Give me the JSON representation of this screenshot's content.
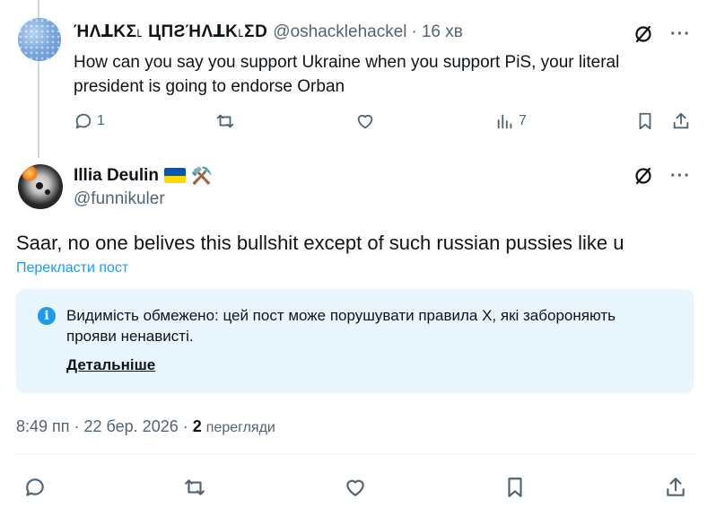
{
  "reply": {
    "author_name": "ΉΛꓕΚΣ˪ ЦПƧΉΛꓕΚ˪ΣD",
    "handle": "@oshacklehackel",
    "separator": "·",
    "time": "16 хв",
    "text": "How can you say you support Ukraine when you support PiS, your literal president is going to endorse Orban",
    "more_label": "···",
    "actions": {
      "replies": "1",
      "reposts": "",
      "likes": "",
      "views": "7"
    }
  },
  "main": {
    "author_name": "Illia Deulin",
    "emoji_tools": "⚒️",
    "handle": "@funnikuler",
    "more_label": "···",
    "text": "Saar, no one belives this bullshit except of such russian pussies like u",
    "translate_label": "Перекласти пост",
    "notice": {
      "info_glyph": "i",
      "text": "Видимість обмежено: цей пост може порушувати правила X, які забороняють прояви ненависті.",
      "link_label": "Детальніше"
    },
    "timestamp": "8:49 пп · 22 бер. 2026 · ",
    "views_count": "2",
    "views_label": "перегляди"
  },
  "colors": {
    "accent": "#1d9bf0",
    "text_secondary": "#536471",
    "notice_bg": "#e8f5fd",
    "flag_blue": "#0057b7",
    "flag_yellow": "#ffd700"
  },
  "icons": [
    "grok-icon",
    "more-icon",
    "reply-icon",
    "repost-icon",
    "like-icon",
    "views-icon",
    "bookmark-icon",
    "share-icon",
    "info-icon"
  ]
}
